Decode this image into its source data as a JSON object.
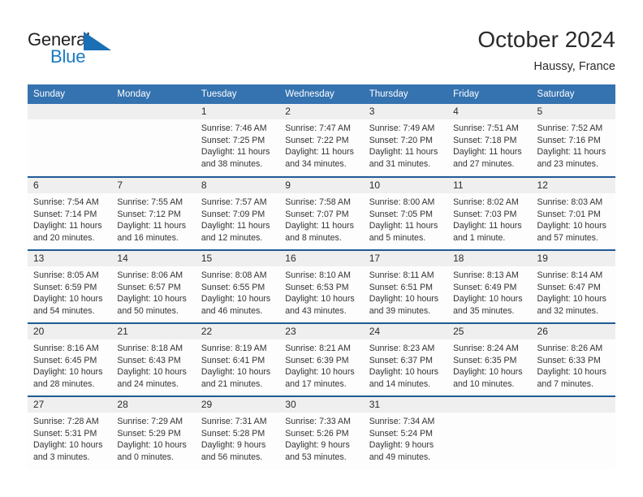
{
  "brand": {
    "name_top": "General",
    "name_bottom": "Blue",
    "triangle_color": "#1a6fb5",
    "blue_color": "#1a7ac4"
  },
  "header": {
    "title": "October 2024",
    "subtitle": "Haussy, France"
  },
  "theme": {
    "header_blue": "#3572b0",
    "row_border_blue": "#1f5b94",
    "daynum_band": "#efefef",
    "cell_bg": "#fdfdfd"
  },
  "weekdays": [
    "Sunday",
    "Monday",
    "Tuesday",
    "Wednesday",
    "Thursday",
    "Friday",
    "Saturday"
  ],
  "weeks": [
    [
      {
        "day": "",
        "sunrise": "",
        "sunset": "",
        "daylight_1": "",
        "daylight_2": ""
      },
      {
        "day": "",
        "sunrise": "",
        "sunset": "",
        "daylight_1": "",
        "daylight_2": ""
      },
      {
        "day": "1",
        "sunrise": "Sunrise: 7:46 AM",
        "sunset": "Sunset: 7:25 PM",
        "daylight_1": "Daylight: 11 hours",
        "daylight_2": "and 38 minutes."
      },
      {
        "day": "2",
        "sunrise": "Sunrise: 7:47 AM",
        "sunset": "Sunset: 7:22 PM",
        "daylight_1": "Daylight: 11 hours",
        "daylight_2": "and 34 minutes."
      },
      {
        "day": "3",
        "sunrise": "Sunrise: 7:49 AM",
        "sunset": "Sunset: 7:20 PM",
        "daylight_1": "Daylight: 11 hours",
        "daylight_2": "and 31 minutes."
      },
      {
        "day": "4",
        "sunrise": "Sunrise: 7:51 AM",
        "sunset": "Sunset: 7:18 PM",
        "daylight_1": "Daylight: 11 hours",
        "daylight_2": "and 27 minutes."
      },
      {
        "day": "5",
        "sunrise": "Sunrise: 7:52 AM",
        "sunset": "Sunset: 7:16 PM",
        "daylight_1": "Daylight: 11 hours",
        "daylight_2": "and 23 minutes."
      }
    ],
    [
      {
        "day": "6",
        "sunrise": "Sunrise: 7:54 AM",
        "sunset": "Sunset: 7:14 PM",
        "daylight_1": "Daylight: 11 hours",
        "daylight_2": "and 20 minutes."
      },
      {
        "day": "7",
        "sunrise": "Sunrise: 7:55 AM",
        "sunset": "Sunset: 7:12 PM",
        "daylight_1": "Daylight: 11 hours",
        "daylight_2": "and 16 minutes."
      },
      {
        "day": "8",
        "sunrise": "Sunrise: 7:57 AM",
        "sunset": "Sunset: 7:09 PM",
        "daylight_1": "Daylight: 11 hours",
        "daylight_2": "and 12 minutes."
      },
      {
        "day": "9",
        "sunrise": "Sunrise: 7:58 AM",
        "sunset": "Sunset: 7:07 PM",
        "daylight_1": "Daylight: 11 hours",
        "daylight_2": "and 8 minutes."
      },
      {
        "day": "10",
        "sunrise": "Sunrise: 8:00 AM",
        "sunset": "Sunset: 7:05 PM",
        "daylight_1": "Daylight: 11 hours",
        "daylight_2": "and 5 minutes."
      },
      {
        "day": "11",
        "sunrise": "Sunrise: 8:02 AM",
        "sunset": "Sunset: 7:03 PM",
        "daylight_1": "Daylight: 11 hours",
        "daylight_2": "and 1 minute."
      },
      {
        "day": "12",
        "sunrise": "Sunrise: 8:03 AM",
        "sunset": "Sunset: 7:01 PM",
        "daylight_1": "Daylight: 10 hours",
        "daylight_2": "and 57 minutes."
      }
    ],
    [
      {
        "day": "13",
        "sunrise": "Sunrise: 8:05 AM",
        "sunset": "Sunset: 6:59 PM",
        "daylight_1": "Daylight: 10 hours",
        "daylight_2": "and 54 minutes."
      },
      {
        "day": "14",
        "sunrise": "Sunrise: 8:06 AM",
        "sunset": "Sunset: 6:57 PM",
        "daylight_1": "Daylight: 10 hours",
        "daylight_2": "and 50 minutes."
      },
      {
        "day": "15",
        "sunrise": "Sunrise: 8:08 AM",
        "sunset": "Sunset: 6:55 PM",
        "daylight_1": "Daylight: 10 hours",
        "daylight_2": "and 46 minutes."
      },
      {
        "day": "16",
        "sunrise": "Sunrise: 8:10 AM",
        "sunset": "Sunset: 6:53 PM",
        "daylight_1": "Daylight: 10 hours",
        "daylight_2": "and 43 minutes."
      },
      {
        "day": "17",
        "sunrise": "Sunrise: 8:11 AM",
        "sunset": "Sunset: 6:51 PM",
        "daylight_1": "Daylight: 10 hours",
        "daylight_2": "and 39 minutes."
      },
      {
        "day": "18",
        "sunrise": "Sunrise: 8:13 AM",
        "sunset": "Sunset: 6:49 PM",
        "daylight_1": "Daylight: 10 hours",
        "daylight_2": "and 35 minutes."
      },
      {
        "day": "19",
        "sunrise": "Sunrise: 8:14 AM",
        "sunset": "Sunset: 6:47 PM",
        "daylight_1": "Daylight: 10 hours",
        "daylight_2": "and 32 minutes."
      }
    ],
    [
      {
        "day": "20",
        "sunrise": "Sunrise: 8:16 AM",
        "sunset": "Sunset: 6:45 PM",
        "daylight_1": "Daylight: 10 hours",
        "daylight_2": "and 28 minutes."
      },
      {
        "day": "21",
        "sunrise": "Sunrise: 8:18 AM",
        "sunset": "Sunset: 6:43 PM",
        "daylight_1": "Daylight: 10 hours",
        "daylight_2": "and 24 minutes."
      },
      {
        "day": "22",
        "sunrise": "Sunrise: 8:19 AM",
        "sunset": "Sunset: 6:41 PM",
        "daylight_1": "Daylight: 10 hours",
        "daylight_2": "and 21 minutes."
      },
      {
        "day": "23",
        "sunrise": "Sunrise: 8:21 AM",
        "sunset": "Sunset: 6:39 PM",
        "daylight_1": "Daylight: 10 hours",
        "daylight_2": "and 17 minutes."
      },
      {
        "day": "24",
        "sunrise": "Sunrise: 8:23 AM",
        "sunset": "Sunset: 6:37 PM",
        "daylight_1": "Daylight: 10 hours",
        "daylight_2": "and 14 minutes."
      },
      {
        "day": "25",
        "sunrise": "Sunrise: 8:24 AM",
        "sunset": "Sunset: 6:35 PM",
        "daylight_1": "Daylight: 10 hours",
        "daylight_2": "and 10 minutes."
      },
      {
        "day": "26",
        "sunrise": "Sunrise: 8:26 AM",
        "sunset": "Sunset: 6:33 PM",
        "daylight_1": "Daylight: 10 hours",
        "daylight_2": "and 7 minutes."
      }
    ],
    [
      {
        "day": "27",
        "sunrise": "Sunrise: 7:28 AM",
        "sunset": "Sunset: 5:31 PM",
        "daylight_1": "Daylight: 10 hours",
        "daylight_2": "and 3 minutes."
      },
      {
        "day": "28",
        "sunrise": "Sunrise: 7:29 AM",
        "sunset": "Sunset: 5:29 PM",
        "daylight_1": "Daylight: 10 hours",
        "daylight_2": "and 0 minutes."
      },
      {
        "day": "29",
        "sunrise": "Sunrise: 7:31 AM",
        "sunset": "Sunset: 5:28 PM",
        "daylight_1": "Daylight: 9 hours",
        "daylight_2": "and 56 minutes."
      },
      {
        "day": "30",
        "sunrise": "Sunrise: 7:33 AM",
        "sunset": "Sunset: 5:26 PM",
        "daylight_1": "Daylight: 9 hours",
        "daylight_2": "and 53 minutes."
      },
      {
        "day": "31",
        "sunrise": "Sunrise: 7:34 AM",
        "sunset": "Sunset: 5:24 PM",
        "daylight_1": "Daylight: 9 hours",
        "daylight_2": "and 49 minutes."
      },
      {
        "day": "",
        "sunrise": "",
        "sunset": "",
        "daylight_1": "",
        "daylight_2": ""
      },
      {
        "day": "",
        "sunrise": "",
        "sunset": "",
        "daylight_1": "",
        "daylight_2": ""
      }
    ]
  ]
}
